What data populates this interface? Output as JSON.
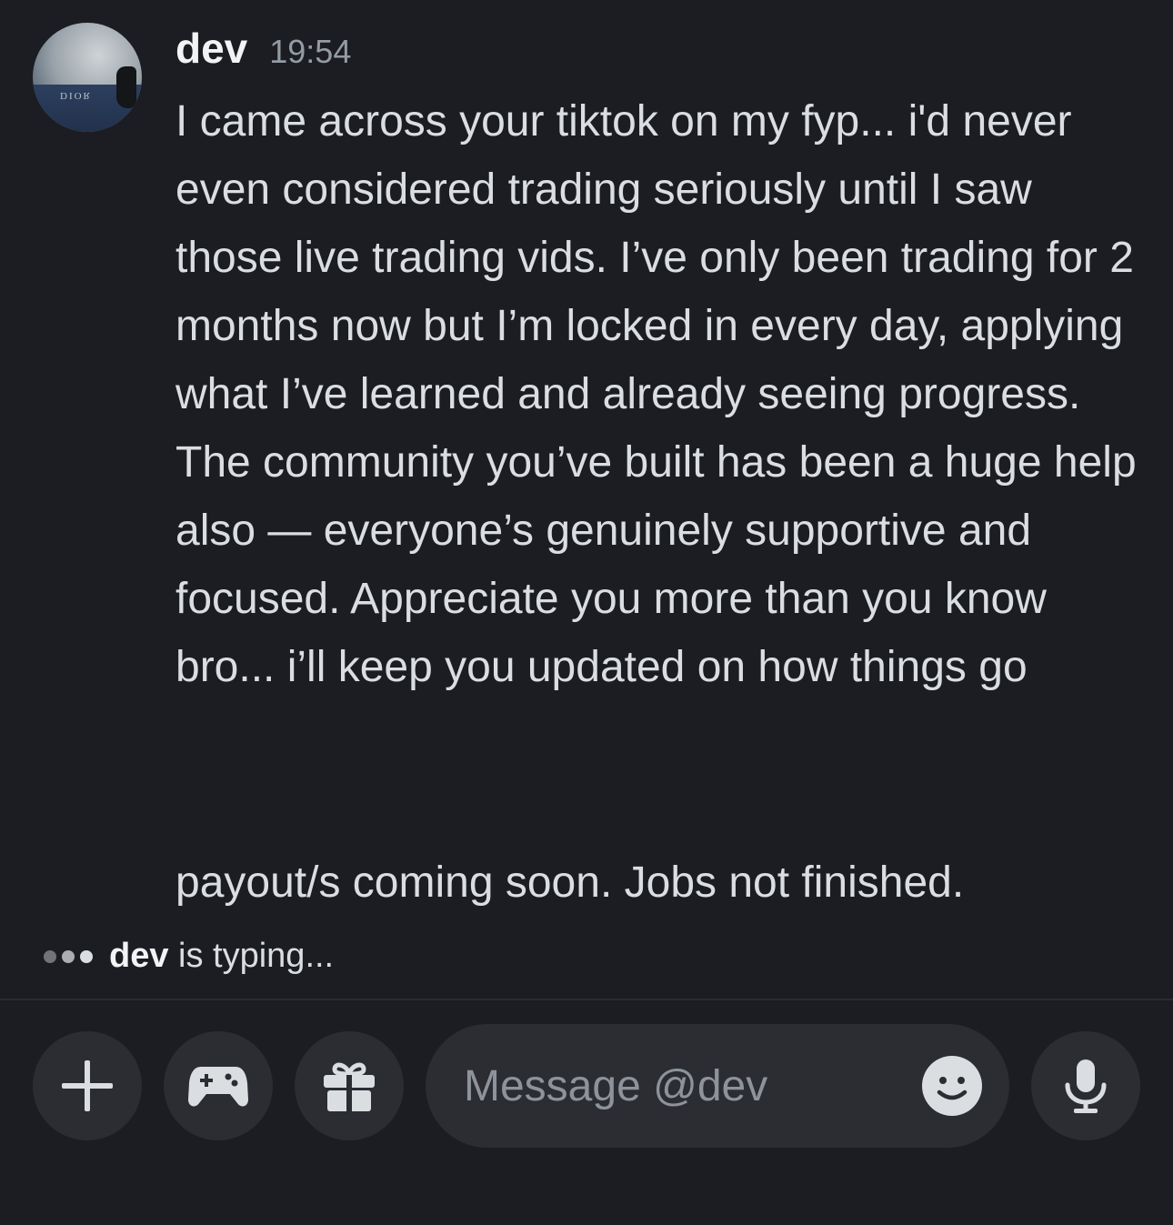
{
  "message": {
    "author": "dev",
    "timestamp": "19:54",
    "avatar_label": "DIOR",
    "paragraphs": [
      "I came across your tiktok on my fyp... i'd never even considered trading seriously until I saw those live trading vids. I’ve only been trading for 2 months now but I’m locked in every day, applying what I’ve learned and already seeing progress. The community you’ve built has been a huge help also — everyone’s genuinely supportive and focused. Appreciate you more than you know bro... i’ll keep you updated on how things go",
      "payout/s coming soon. Jobs not finished."
    ]
  },
  "typing_indicator": {
    "user": "dev",
    "text": " is typing..."
  },
  "composer": {
    "placeholder": "Message @dev",
    "buttons": [
      "plus-icon",
      "gamepad-icon",
      "gift-icon",
      "emoji-icon",
      "microphone-icon"
    ]
  },
  "colors": {
    "background": "#1c1d22",
    "button_bg": "#2b2d33",
    "text": "#dbdee1",
    "muted": "#949ba4"
  }
}
